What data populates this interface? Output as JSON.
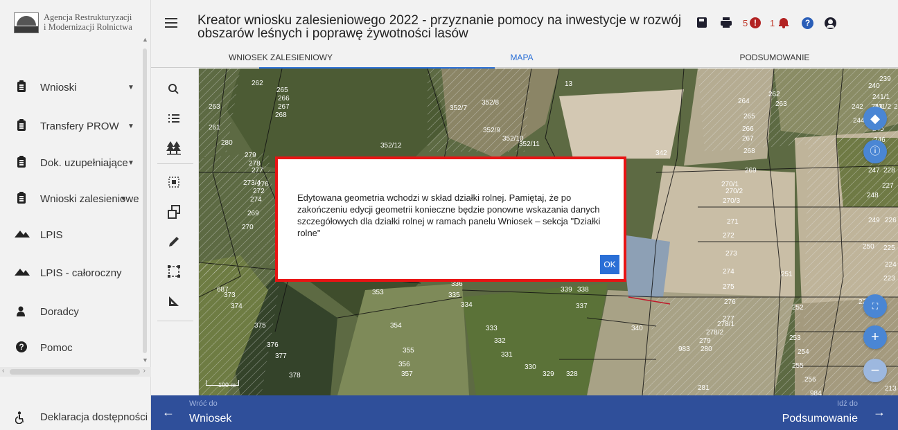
{
  "logo": {
    "line1": "Agencja Restrukturyzacji",
    "line2": "i Modernizacji Rolnictwa",
    "abbr": "ARiMR"
  },
  "sidebar": {
    "items": [
      {
        "label": "Wnioski",
        "icon": "clipboard-icon",
        "has_chevron": true
      },
      {
        "label": "Transfery PROW",
        "icon": "clipboard-icon",
        "has_chevron": true
      },
      {
        "label": "Dok. uzupełniające",
        "icon": "clipboard-icon",
        "has_chevron": true
      },
      {
        "label": "Wnioski zalesieniowe",
        "icon": "clipboard-icon",
        "has_chevron": true
      },
      {
        "label": "LPIS",
        "icon": "mountains-icon",
        "has_chevron": false
      },
      {
        "label": "LPIS - całoroczny",
        "icon": "mountains-icon",
        "has_chevron": false
      },
      {
        "label": "Doradcy",
        "icon": "person-icon",
        "has_chevron": false
      },
      {
        "label": "Pomoc",
        "icon": "question-circle-icon",
        "has_chevron": false
      }
    ],
    "footer": {
      "label": "Deklaracja dostępności",
      "icon": "accessibility-icon"
    }
  },
  "header": {
    "title": "Kreator wniosku zalesieniowego 2022 - przyznanie pomocy na inwestycje w rozwój obszarów leśnych i poprawę żywotności lasów",
    "error_count": "5",
    "notification_count": "1",
    "error_symbol": "!",
    "help_symbol": "?"
  },
  "tabs": [
    {
      "label": "WNIOSEK ZALESIENIOWY",
      "active": false
    },
    {
      "label": "MAPA",
      "active": true
    },
    {
      "label": "PODSUMOWANIE",
      "active": false
    }
  ],
  "tools": [
    "search-icon",
    "list-icon",
    "trees-icon",
    "select-area-icon",
    "copy-geometry-icon",
    "pencil-icon",
    "rectangle-select-icon",
    "measure-angle-icon"
  ],
  "map": {
    "scale_label": "100 m",
    "accent": "#4a86d4",
    "parcel_labels": [
      "262",
      "265",
      "266",
      "267",
      "268",
      "263",
      "261",
      "280",
      "279",
      "278",
      "277",
      "276",
      "273/4",
      "272",
      "274",
      "269",
      "270",
      "352/7",
      "352/8",
      "352/9",
      "352/10",
      "352/11",
      "352/12",
      "13",
      "342",
      "264",
      "262",
      "263",
      "240",
      "241/1",
      "241/2",
      "243",
      "242",
      "244",
      "245",
      "246",
      "265",
      "266",
      "267",
      "268",
      "269",
      "270/1",
      "270/2",
      "270/3",
      "271",
      "272",
      "273",
      "274",
      "275",
      "276",
      "277",
      "278/1",
      "278/2",
      "279",
      "280",
      "281",
      "247",
      "248",
      "249",
      "250",
      "251",
      "252",
      "253",
      "254",
      "255",
      "256",
      "984",
      "983",
      "231",
      "228",
      "227",
      "226",
      "225",
      "224",
      "223",
      "221",
      "239",
      "687",
      "373",
      "374",
      "375",
      "376",
      "377",
      "378",
      "353",
      "354",
      "355",
      "356",
      "357",
      "335",
      "336",
      "334",
      "333",
      "332",
      "331",
      "330",
      "329",
      "328",
      "337",
      "338",
      "339",
      "340",
      "213"
    ]
  },
  "modal": {
    "message": "Edytowana geometria wchodzi w skład działki rolnej. Pamiętaj, że po zakończeniu edycji geometrii konieczne będzie ponowne wskazania danych szczegółowych dla działki rolnej w ramach panelu Wniosek – sekcja \"Działki rolne\"",
    "ok_label": "OK",
    "border_color": "#e81414"
  },
  "bottombar": {
    "back_small": "Wróć do",
    "back_big": "Wniosek",
    "next_small": "Idź do",
    "next_big": "Podsumowanie",
    "color": "#2f4f9a"
  }
}
